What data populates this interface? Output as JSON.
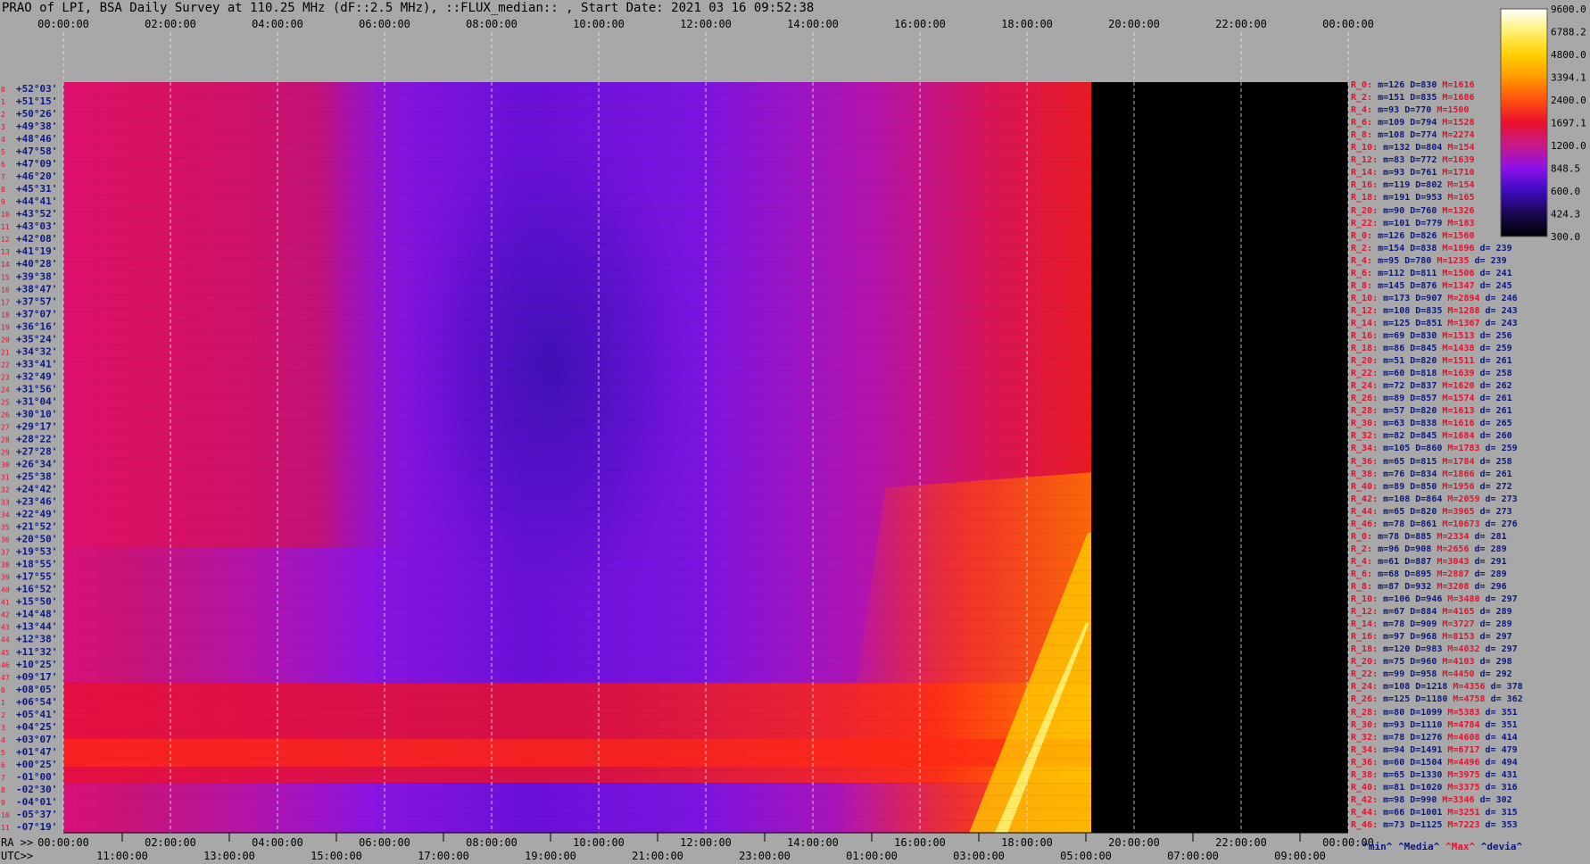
{
  "title": "PRAO of LPI, BSA Daily Survey at 110.25 MHz (dF::2.5 MHz), ::FLUX_median:: , Start Date: 2021 03 16 09:52:38",
  "chart_data": {
    "type": "heatmap",
    "title": "PRAO of LPI, BSA Daily Survey at 110.25 MHz (dF::2.5 MHz), ::FLUX_median:: , Start Date: 2021 03 16 09:52:38",
    "x_top_ticks": [
      "00:00:00",
      "02:00:00",
      "04:00:00",
      "06:00:00",
      "08:00:00",
      "10:00:00",
      "12:00:00",
      "14:00:00",
      "16:00:00",
      "18:00:00",
      "20:00:00",
      "22:00:00",
      "00:00:00"
    ],
    "x_bottom_ra_label": "RA >>",
    "x_bottom_ra_ticks": [
      "00:00:00",
      "02:00:00",
      "04:00:00",
      "06:00:00",
      "08:00:00",
      "10:00:00",
      "12:00:00",
      "14:00:00",
      "16:00:00",
      "18:00:00",
      "20:00:00",
      "22:00:00",
      "00:00:00"
    ],
    "x_bottom_utc_label": "UTC>>",
    "x_bottom_utc_ticks": [
      "11:0",
      "13:0",
      "15:0",
      "17:0",
      "19:0",
      "21:0",
      "23:0",
      "01:0",
      "03:0",
      "05:0",
      "07:0",
      "09:0"
    ],
    "x_bottom_utc_suffix": "0:00",
    "data_end_fraction": 0.8,
    "y_labels": [
      "+52°03'",
      "+51°15'",
      "+50°26'",
      "+49°38'",
      "+48°46'",
      "+47°58'",
      "+47°09'",
      "+46°20'",
      "+45°31'",
      "+44°41'",
      "+43°52'",
      "+43°03'",
      "+42°08'",
      "+41°19'",
      "+40°28'",
      "+39°38'",
      "+38°47'",
      "+37°57'",
      "+37°07'",
      "+36°16'",
      "+35°24'",
      "+34°32'",
      "+33°41'",
      "+32°49'",
      "+31°56'",
      "+31°04'",
      "+30°10'",
      "+29°17'",
      "+28°22'",
      "+27°28'",
      "+26°34'",
      "+25°38'",
      "+24°42'",
      "+23°46'",
      "+22°49'",
      "+21°52'",
      "+20°50'",
      "+19°53'",
      "+18°55'",
      "+17°55'",
      "+16°52'",
      "+15°50'",
      "+14°48'",
      "+13°44'",
      "+12°38'",
      "+11°32'",
      "+10°25'",
      "+09°17'",
      "+08°05'",
      "+06°54'",
      "+05°41'",
      "+04°25'",
      "+03°07'",
      "+01°47'",
      "+00°25'",
      "-01°00'",
      "-02°30'",
      "-04°01'",
      "-05°37'",
      "-07°19'"
    ],
    "colorbar": {
      "ticks": [
        "9600.0",
        "6788.2",
        "4800.0",
        "3394.1",
        "2400.0",
        "1697.1",
        "1200.0",
        "848.5",
        "600.0",
        "424.3",
        "300.0"
      ],
      "colors": [
        "#ffffff",
        "#fff070",
        "#ffd000",
        "#ff9a00",
        "#ff5010",
        "#e8102c",
        "#c81a8a",
        "#8c10e8",
        "#3c0cc0",
        "#1a0650",
        "#000000"
      ]
    },
    "stats": [
      {
        "r": "R_0:",
        "m": "m=126",
        "d": "D=830",
        "x": "M=1616",
        "dev": ""
      },
      {
        "r": "R_2:",
        "m": "m=151",
        "d": "D=835",
        "x": "M=1686",
        "dev": ""
      },
      {
        "r": "R_4:",
        "m": "m=93",
        "d": "D=770",
        "x": "M=1500",
        "dev": ""
      },
      {
        "r": "R_6:",
        "m": "m=109",
        "d": "D=794",
        "x": "M=1528",
        "dev": ""
      },
      {
        "r": "R_8:",
        "m": "m=108",
        "d": "D=774",
        "x": "M=2274",
        "dev": ""
      },
      {
        "r": "R_10:",
        "m": "m=132",
        "d": "D=804",
        "x": "M=154",
        "dev": ""
      },
      {
        "r": "R_12:",
        "m": "m=83",
        "d": "D=772",
        "x": "M=1639",
        "dev": ""
      },
      {
        "r": "R_14:",
        "m": "m=93",
        "d": "D=761",
        "x": "M=1710",
        "dev": ""
      },
      {
        "r": "R_16:",
        "m": "m=119",
        "d": "D=802",
        "x": "M=154",
        "dev": ""
      },
      {
        "r": "R_18:",
        "m": "m=191",
        "d": "D=953",
        "x": "M=165",
        "dev": ""
      },
      {
        "r": "R_20:",
        "m": "m=90",
        "d": "D=760",
        "x": "M=1326",
        "dev": ""
      },
      {
        "r": "R_22:",
        "m": "m=101",
        "d": "D=779",
        "x": "M=183",
        "dev": ""
      },
      {
        "r": "R_0:",
        "m": "m=126",
        "d": "D=826",
        "x": "M=1560",
        "dev": ""
      },
      {
        "r": "R_2:",
        "m": "m=154",
        "d": "D=838",
        "x": "M=1896",
        "dev": "d= 239"
      },
      {
        "r": "R_4:",
        "m": "m=95",
        "d": "D=780",
        "x": "M=1235",
        "dev": "d= 239"
      },
      {
        "r": "R_6:",
        "m": "m=112",
        "d": "D=811",
        "x": "M=1506",
        "dev": "d= 241"
      },
      {
        "r": "R_8:",
        "m": "m=145",
        "d": "D=876",
        "x": "M=1347",
        "dev": "d= 245"
      },
      {
        "r": "R_10:",
        "m": "m=173",
        "d": "D=907",
        "x": "M=2894",
        "dev": "d= 246"
      },
      {
        "r": "R_12:",
        "m": "m=108",
        "d": "D=835",
        "x": "M=1288",
        "dev": "d= 243"
      },
      {
        "r": "R_14:",
        "m": "m=125",
        "d": "D=851",
        "x": "M=1367",
        "dev": "d= 243"
      },
      {
        "r": "R_16:",
        "m": "m=69",
        "d": "D=830",
        "x": "M=1513",
        "dev": "d= 256"
      },
      {
        "r": "R_18:",
        "m": "m=86",
        "d": "D=845",
        "x": "M=1438",
        "dev": "d= 259"
      },
      {
        "r": "R_20:",
        "m": "m=51",
        "d": "D=820",
        "x": "M=1511",
        "dev": "d= 261"
      },
      {
        "r": "R_22:",
        "m": "m=60",
        "d": "D=818",
        "x": "M=1639",
        "dev": "d= 258"
      },
      {
        "r": "R_24:",
        "m": "m=72",
        "d": "D=837",
        "x": "M=1620",
        "dev": "d= 262"
      },
      {
        "r": "R_26:",
        "m": "m=89",
        "d": "D=857",
        "x": "M=1574",
        "dev": "d= 261"
      },
      {
        "r": "R_28:",
        "m": "m=57",
        "d": "D=820",
        "x": "M=1613",
        "dev": "d= 261"
      },
      {
        "r": "R_30:",
        "m": "m=63",
        "d": "D=838",
        "x": "M=1616",
        "dev": "d= 265"
      },
      {
        "r": "R_32:",
        "m": "m=82",
        "d": "D=845",
        "x": "M=1684",
        "dev": "d= 260"
      },
      {
        "r": "R_34:",
        "m": "m=105",
        "d": "D=860",
        "x": "M=1783",
        "dev": "d= 259"
      },
      {
        "r": "R_36:",
        "m": "m=65",
        "d": "D=815",
        "x": "M=1784",
        "dev": "d= 258"
      },
      {
        "r": "R_38:",
        "m": "m=76",
        "d": "D=834",
        "x": "M=1866",
        "dev": "d= 261"
      },
      {
        "r": "R_40:",
        "m": "m=89",
        "d": "D=850",
        "x": "M=1956",
        "dev": "d= 272"
      },
      {
        "r": "R_42:",
        "m": "m=108",
        "d": "D=864",
        "x": "M=2059",
        "dev": "d= 273"
      },
      {
        "r": "R_44:",
        "m": "m=65",
        "d": "D=820",
        "x": "M=3965",
        "dev": "d= 273"
      },
      {
        "r": "R_46:",
        "m": "m=78",
        "d": "D=861",
        "x": "M=10673",
        "dev": "d= 276"
      },
      {
        "r": "R_0:",
        "m": "m=78",
        "d": "D=885",
        "x": "M=2334",
        "dev": "d= 281"
      },
      {
        "r": "R_2:",
        "m": "m=96",
        "d": "D=908",
        "x": "M=2656",
        "dev": "d= 289"
      },
      {
        "r": "R_4:",
        "m": "m=61",
        "d": "D=887",
        "x": "M=3043",
        "dev": "d= 291"
      },
      {
        "r": "R_6:",
        "m": "m=68",
        "d": "D=895",
        "x": "M=2887",
        "dev": "d= 289"
      },
      {
        "r": "R_8:",
        "m": "m=87",
        "d": "D=932",
        "x": "M=3208",
        "dev": "d= 296"
      },
      {
        "r": "R_10:",
        "m": "m=106",
        "d": "D=946",
        "x": "M=3480",
        "dev": "d= 297"
      },
      {
        "r": "R_12:",
        "m": "m=67",
        "d": "D=884",
        "x": "M=4165",
        "dev": "d= 289"
      },
      {
        "r": "R_14:",
        "m": "m=78",
        "d": "D=909",
        "x": "M=3727",
        "dev": "d= 289"
      },
      {
        "r": "R_16:",
        "m": "m=97",
        "d": "D=968",
        "x": "M=8153",
        "dev": "d= 297"
      },
      {
        "r": "R_18:",
        "m": "m=120",
        "d": "D=983",
        "x": "M=4032",
        "dev": "d= 297"
      },
      {
        "r": "R_20:",
        "m": "m=75",
        "d": "D=960",
        "x": "M=4103",
        "dev": "d= 298"
      },
      {
        "r": "R_22:",
        "m": "m=99",
        "d": "D=958",
        "x": "M=4450",
        "dev": "d= 292"
      },
      {
        "r": "R_24:",
        "m": "m=108",
        "d": "D=1218",
        "x": "M=4356",
        "dev": "d= 378"
      },
      {
        "r": "R_26:",
        "m": "m=125",
        "d": "D=1180",
        "x": "M=4758",
        "dev": "d= 362"
      },
      {
        "r": "R_28:",
        "m": "m=80",
        "d": "D=1099",
        "x": "M=5383",
        "dev": "d= 351"
      },
      {
        "r": "R_30:",
        "m": "m=93",
        "d": "D=1110",
        "x": "M=4784",
        "dev": "d= 351"
      },
      {
        "r": "R_32:",
        "m": "m=78",
        "d": "D=1276",
        "x": "M=4608",
        "dev": "d= 414"
      },
      {
        "r": "R_34:",
        "m": "m=94",
        "d": "D=1491",
        "x": "M=6717",
        "dev": "d= 479"
      },
      {
        "r": "R_36:",
        "m": "m=60",
        "d": "D=1504",
        "x": "M=4496",
        "dev": "d= 494"
      },
      {
        "r": "R_38:",
        "m": "m=65",
        "d": "D=1330",
        "x": "M=3975",
        "dev": "d= 431"
      },
      {
        "r": "R_40:",
        "m": "m=81",
        "d": "D=1020",
        "x": "M=3375",
        "dev": "d= 316"
      },
      {
        "r": "R_42:",
        "m": "m=98",
        "d": "D=990",
        "x": "M=3346",
        "dev": "d= 302"
      },
      {
        "r": "R_44:",
        "m": "m=66",
        "d": "D=1001",
        "x": "M=3251",
        "dev": "d= 315"
      },
      {
        "r": "R_46:",
        "m": "m=73",
        "d": "D=1125",
        "x": "M=7223",
        "dev": "d= 353"
      }
    ],
    "legend_footer": {
      "min": "^min^",
      "median": "^Media^",
      "max": "^Max^",
      "devia": "^devia^"
    }
  }
}
